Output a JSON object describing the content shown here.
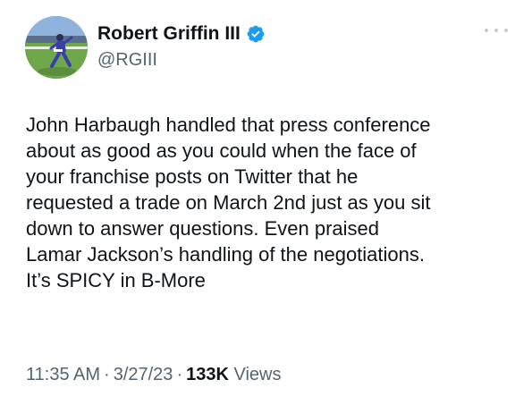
{
  "author": {
    "display_name": "Robert Griffin III",
    "handle": "@RGIII",
    "verified": true,
    "avatar_icon": "football-player-avatar"
  },
  "menu": {
    "icon": "more-options-icon"
  },
  "tweet": {
    "lines": [
      "John Harbaugh handled that press conference",
      "about as good as you could when the face of",
      "your franchise posts on Twitter that he",
      "requested a trade on March 2nd just as you sit",
      "down to answer questions. Even praised",
      "Lamar Jackson’s handling of the negotiations.",
      "It’s SPICY in B-More"
    ]
  },
  "meta": {
    "time": "11:35 AM",
    "separator": "·",
    "date": "3/27/23",
    "views_count": "133K",
    "views_label": "Views"
  },
  "colors": {
    "text_primary": "#0f1419",
    "text_secondary": "#536471",
    "verified_blue": "#1d9bf0"
  }
}
